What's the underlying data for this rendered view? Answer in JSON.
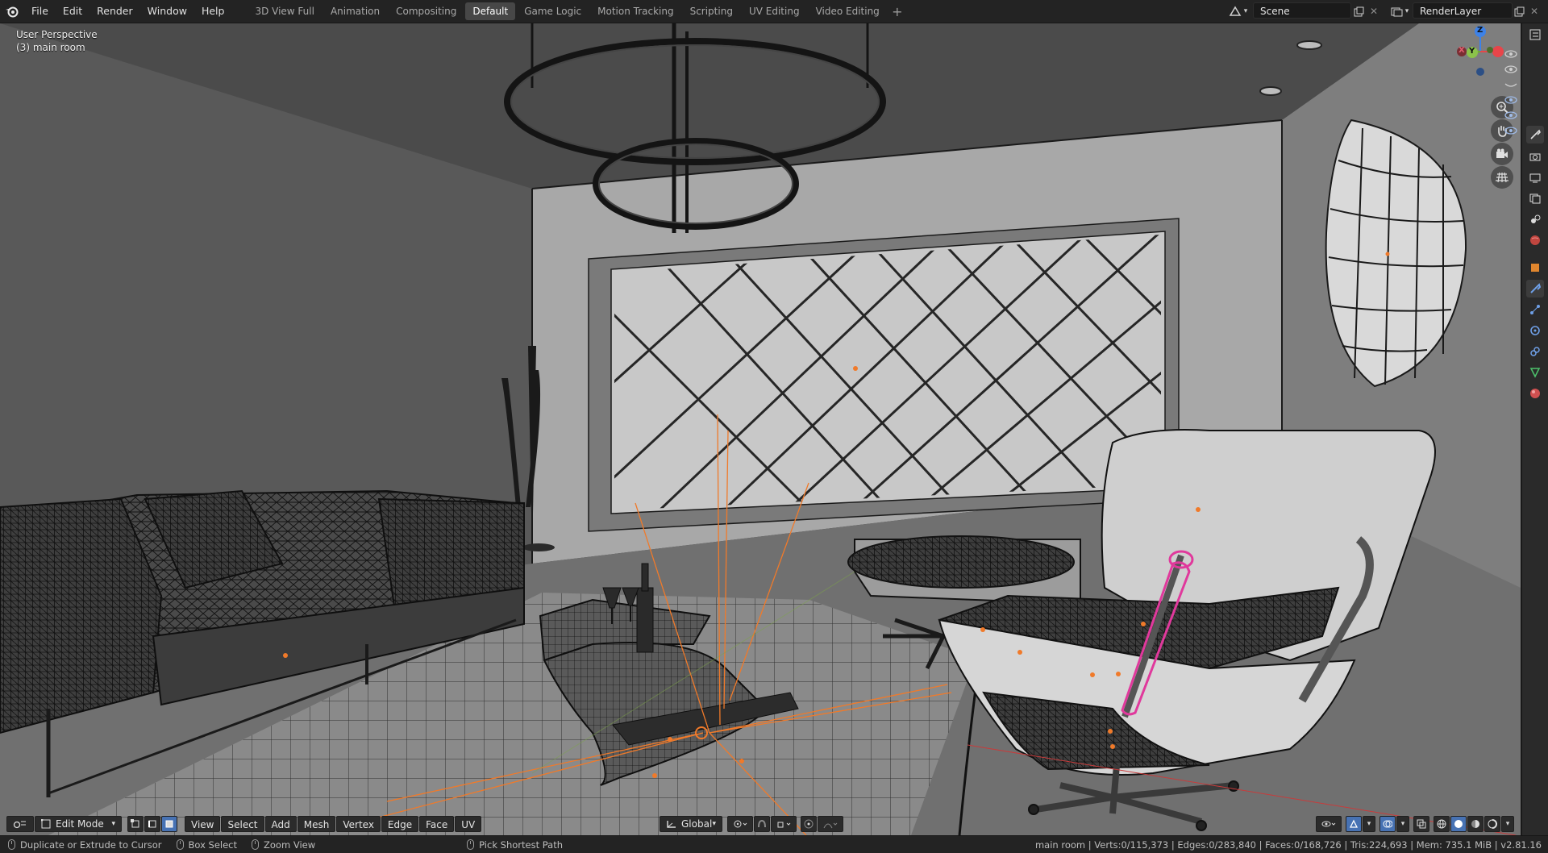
{
  "menu": [
    "File",
    "Edit",
    "Render",
    "Window",
    "Help"
  ],
  "workspaces": {
    "tabs": [
      "3D View Full",
      "Animation",
      "Compositing",
      "Default",
      "Game Logic",
      "Motion Tracking",
      "Scripting",
      "UV Editing",
      "Video Editing"
    ],
    "active": "Default",
    "add": "+"
  },
  "scene": {
    "label": "Scene"
  },
  "render_layer": {
    "label": "RenderLayer"
  },
  "viewport": {
    "perspective": "User Perspective",
    "collection": "(3) main room",
    "gizmo": {
      "x": "X",
      "y": "Y",
      "z": "Z"
    }
  },
  "header": {
    "mode": "Edit Mode",
    "menus": [
      "View",
      "Select",
      "Add",
      "Mesh",
      "Vertex",
      "Edge",
      "Face",
      "UV"
    ],
    "orientation": "Global"
  },
  "status": {
    "left_click": "Duplicate or Extrude to Cursor",
    "box_select": "Box Select",
    "zoom": "Zoom View",
    "pick": "Pick Shortest Path",
    "stats": "main room | Verts:0/115,373 | Edges:0/283,840 | Faces:0/168,726 | Tris:224,693 | Mem: 735.1 MiB | v2.81.16"
  },
  "colors": {
    "accent": "#4772b3",
    "selected_edge": "#e0399c",
    "object_origin": "#f07a2a"
  }
}
